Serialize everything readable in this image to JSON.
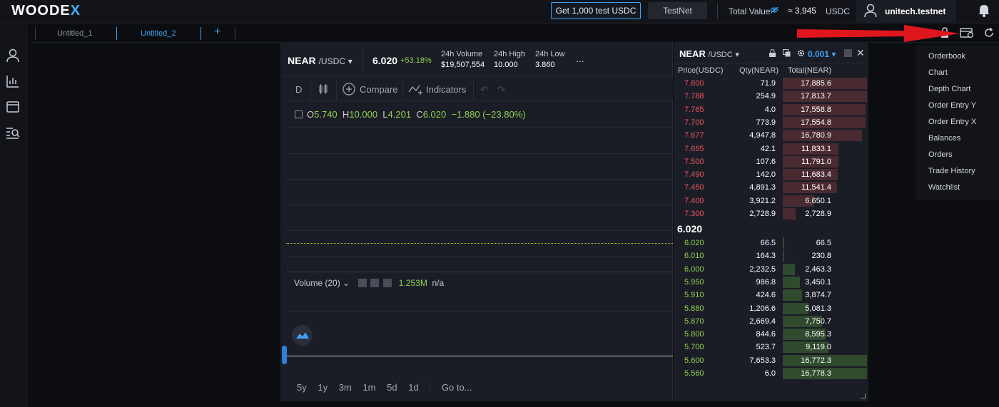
{
  "header": {
    "logo_main": "WOODE",
    "logo_x": "X",
    "test_button": "Get 1,000 test USDC",
    "network_button": "TestNet",
    "total_value_label": "Total Value",
    "total_value_amount": "≈ 3,945",
    "total_value_unit": "USDC",
    "username": "unitech.testnet"
  },
  "tabs": [
    {
      "label": "Untitled_1",
      "active": false
    },
    {
      "label": "Untitled_2",
      "active": true
    }
  ],
  "add_tab_label": "+",
  "chart": {
    "symbol": "NEAR",
    "quote": "/USDC",
    "price": "6.020",
    "change": "+53.18%",
    "stats": [
      {
        "label": "24h Volume",
        "value": "$19,507,554"
      },
      {
        "label": "24h High",
        "value": "10.000"
      },
      {
        "label": "24h Low",
        "value": "3.860"
      }
    ],
    "more": "...",
    "interval": "D",
    "compare_label": "Compare",
    "indicators_label": "Indicators",
    "ohlc": {
      "O": "5.740",
      "H": "10.000",
      "L": "4.201",
      "C": "6.020",
      "change": "−1.880 (−23.80%)"
    },
    "volume_label": "Volume (20)",
    "volume_value": "1.253M",
    "volume_na": "n/a",
    "ranges": [
      "5y",
      "1y",
      "3m",
      "1m",
      "5d",
      "1d"
    ],
    "goto_label": "Go to..."
  },
  "orderbook": {
    "symbol": "NEAR",
    "quote": "/USDC",
    "tick": "0.001",
    "columns": [
      "Price(USDC)",
      "Qty(NEAR)",
      "Total(NEAR)"
    ],
    "mid_price": "6.020",
    "asks": [
      {
        "price": "7.800",
        "qty": "71.9",
        "total": "17,885.6",
        "depth": 1.0
      },
      {
        "price": "7.788",
        "qty": "254.9",
        "total": "17,813.7",
        "depth": 0.996
      },
      {
        "price": "7.765",
        "qty": "4.0",
        "total": "17,558.8",
        "depth": 0.982
      },
      {
        "price": "7.700",
        "qty": "773.9",
        "total": "17,554.8",
        "depth": 0.981
      },
      {
        "price": "7.677",
        "qty": "4,947.8",
        "total": "16,780.9",
        "depth": 0.938
      },
      {
        "price": "7.665",
        "qty": "42.1",
        "total": "11,833.1",
        "depth": 0.661
      },
      {
        "price": "7.500",
        "qty": "107.6",
        "total": "11,791.0",
        "depth": 0.659
      },
      {
        "price": "7.490",
        "qty": "142.0",
        "total": "11,683.4",
        "depth": 0.653
      },
      {
        "price": "7.450",
        "qty": "4,891.3",
        "total": "11,541.4",
        "depth": 0.645
      },
      {
        "price": "7.400",
        "qty": "3,921.2",
        "total": "6,650.1",
        "depth": 0.372
      },
      {
        "price": "7.300",
        "qty": "2,728.9",
        "total": "2,728.9",
        "depth": 0.153
      }
    ],
    "bids": [
      {
        "price": "6.020",
        "qty": "66.5",
        "total": "66.5",
        "depth": 0.004
      },
      {
        "price": "6.010",
        "qty": "164.3",
        "total": "230.8",
        "depth": 0.014
      },
      {
        "price": "6.000",
        "qty": "2,232.5",
        "total": "2,463.3",
        "depth": 0.147
      },
      {
        "price": "5.950",
        "qty": "986.8",
        "total": "3,450.1",
        "depth": 0.206
      },
      {
        "price": "5.910",
        "qty": "424.6",
        "total": "3,874.7",
        "depth": 0.231
      },
      {
        "price": "5.880",
        "qty": "1,206.6",
        "total": "5,081.3",
        "depth": 0.303
      },
      {
        "price": "5.870",
        "qty": "2,669.4",
        "total": "7,750.7",
        "depth": 0.462
      },
      {
        "price": "5.800",
        "qty": "844.6",
        "total": "8,595.3",
        "depth": 0.512
      },
      {
        "price": "5.700",
        "qty": "523.7",
        "total": "9,119.0",
        "depth": 0.544
      },
      {
        "price": "5.600",
        "qty": "7,653.3",
        "total": "16,772.3",
        "depth": 1.0
      },
      {
        "price": "5.560",
        "qty": "6.0",
        "total": "16,778.3",
        "depth": 1.0
      }
    ]
  },
  "widget_menu": [
    "Orderbook",
    "Chart",
    "Depth Chart",
    "Order Entry Y",
    "Order Entry X",
    "Balances",
    "Orders",
    "Trade History",
    "Watchlist"
  ],
  "colors": {
    "accent": "#3ea1f5",
    "ask": "#e8565c",
    "bid": "#8fd14f",
    "arrow": "#e0161d"
  }
}
